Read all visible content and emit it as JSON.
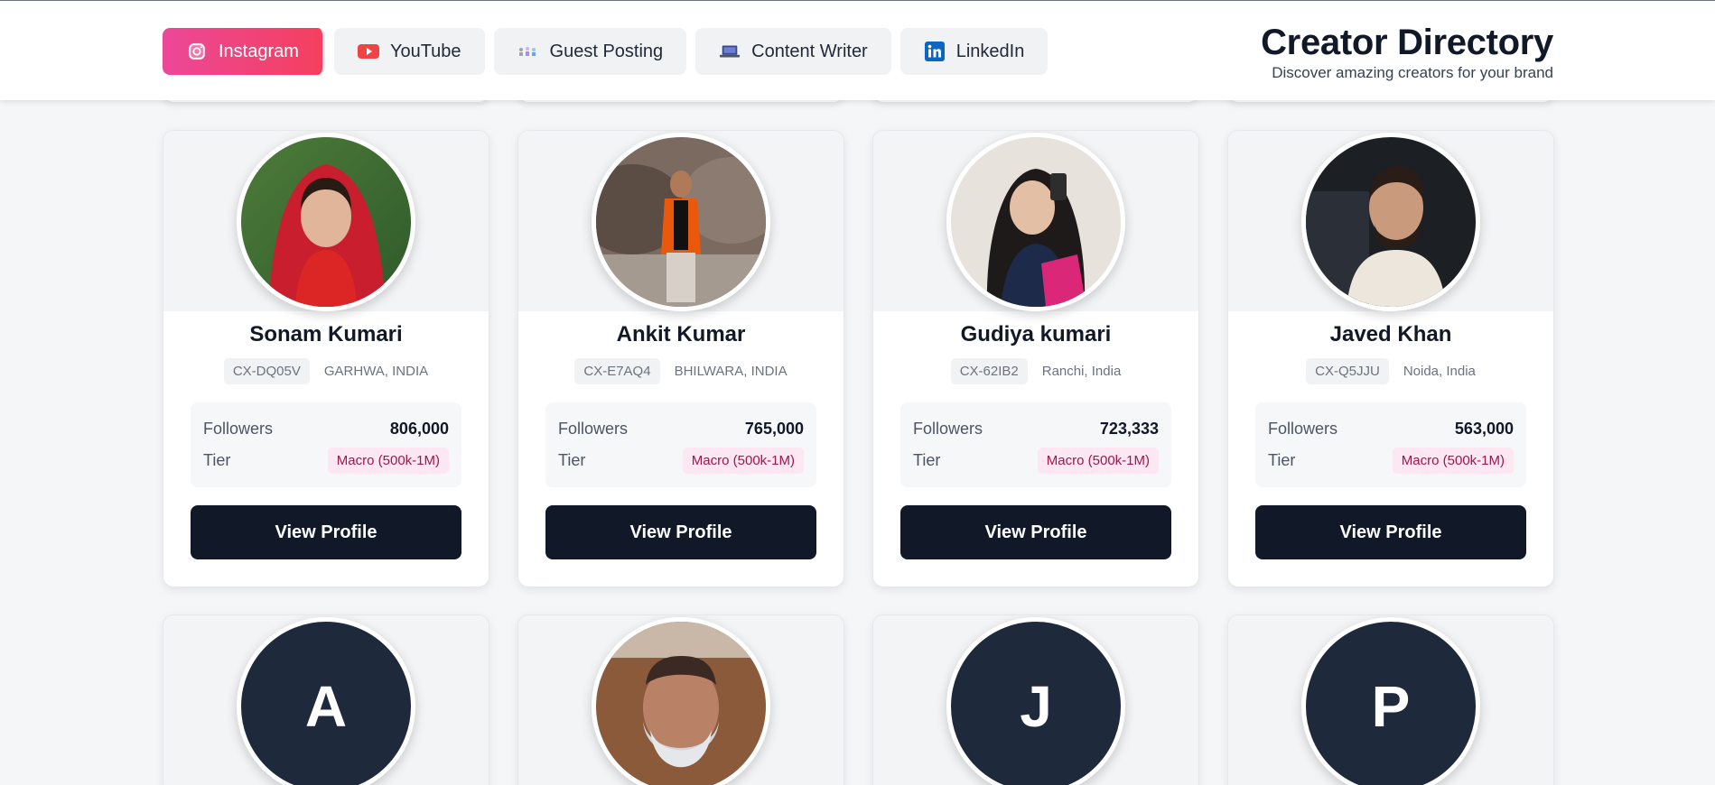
{
  "header": {
    "title": "Creator Directory",
    "subtitle": "Discover amazing creators for your brand",
    "tabs": [
      {
        "label": "Instagram",
        "icon": "instagram-icon",
        "active": true
      },
      {
        "label": "YouTube",
        "icon": "youtube-icon",
        "active": false
      },
      {
        "label": "Guest Posting",
        "icon": "guest-posting-icon",
        "active": false
      },
      {
        "label": "Content Writer",
        "icon": "laptop-icon",
        "active": false
      },
      {
        "label": "LinkedIn",
        "icon": "linkedin-icon",
        "active": false
      }
    ]
  },
  "labels": {
    "followers": "Followers",
    "tier": "Tier",
    "view_profile": "View Profile"
  },
  "creators": [
    {
      "name": "Sonam Kumari",
      "code": "CX-DQ05V",
      "location": "GARHWA, INDIA",
      "followers": "806,000",
      "tier": "Macro (500k-1M)"
    },
    {
      "name": "Ankit Kumar",
      "code": "CX-E7AQ4",
      "location": "BHILWARA, INDIA",
      "followers": "765,000",
      "tier": "Macro (500k-1M)"
    },
    {
      "name": "Gudiya kumari",
      "code": "CX-62IB2",
      "location": "Ranchi, India",
      "followers": "723,333",
      "tier": "Macro (500k-1M)"
    },
    {
      "name": "Javed Khan",
      "code": "CX-Q5JJU",
      "location": "Noida, India",
      "followers": "563,000",
      "tier": "Macro (500k-1M)"
    }
  ],
  "next_row_avatars": [
    "A",
    "",
    "J",
    "P"
  ],
  "colors": {
    "active_tab_start": "#ec4899",
    "active_tab_end": "#f43f5e",
    "button": "#111827",
    "tier_badge_bg": "#fce7f3",
    "tier_badge_text": "#9d174d",
    "avatar_placeholder": "#1e293b"
  }
}
